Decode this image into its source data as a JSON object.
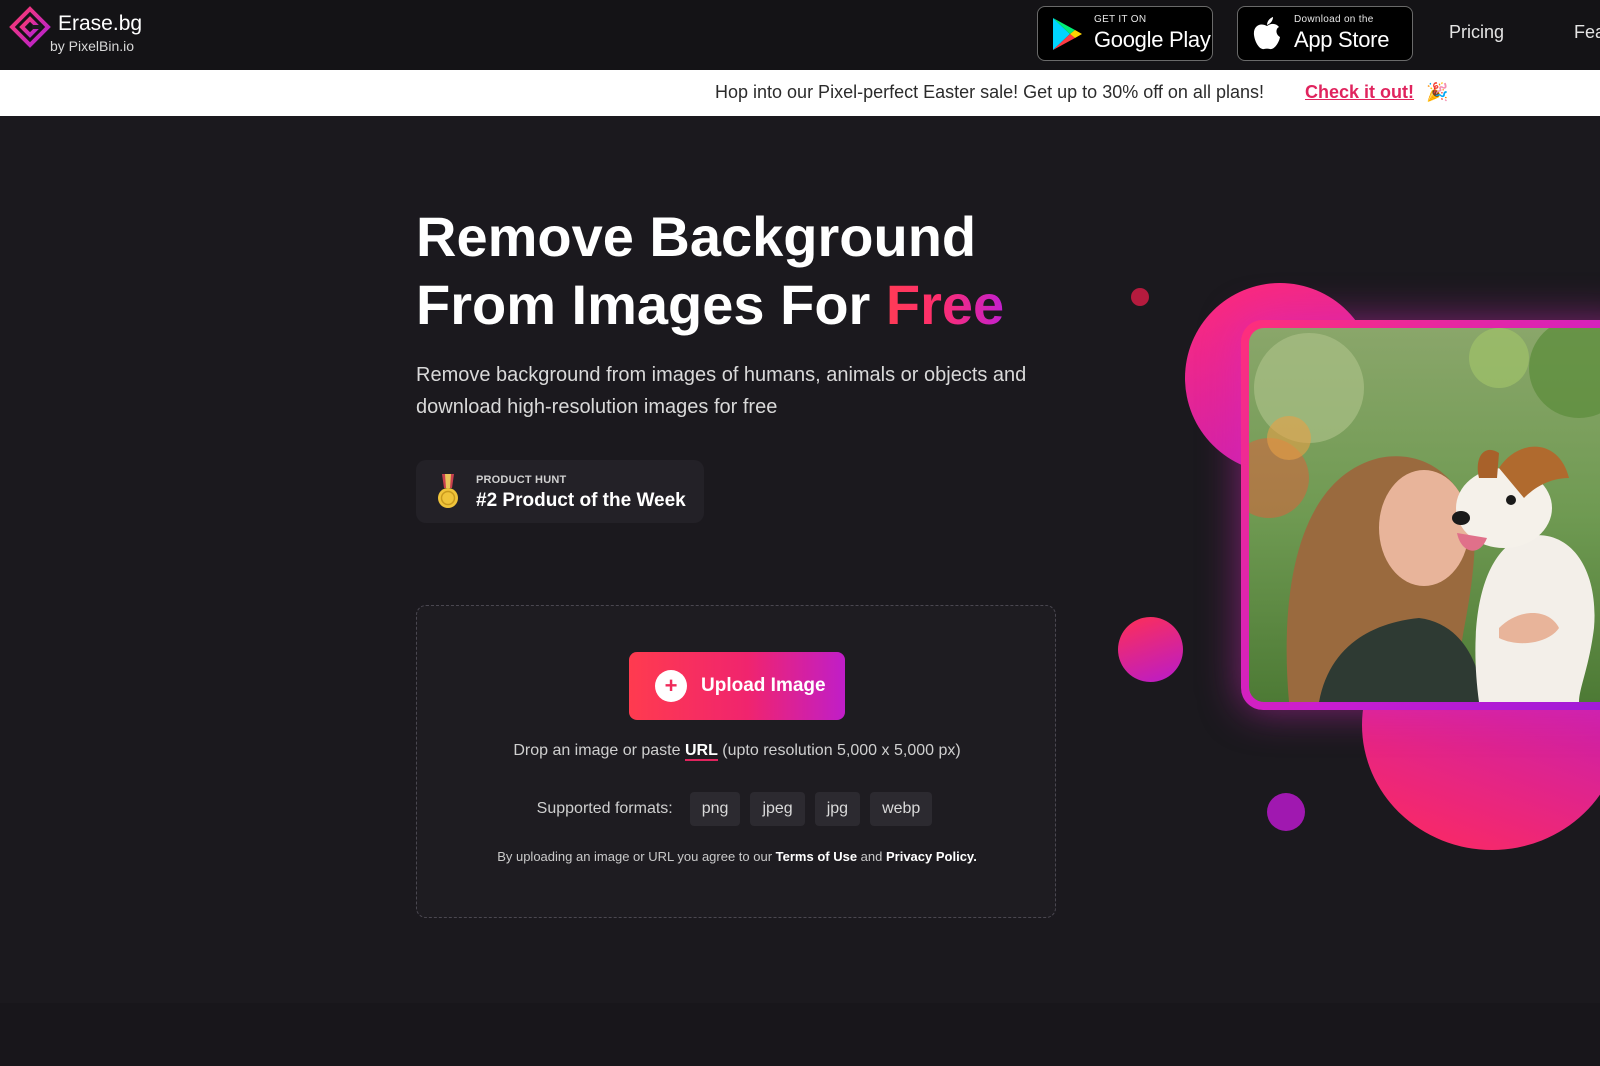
{
  "header": {
    "logo_title": "Erase.bg",
    "logo_sub": "by PixelBin.io",
    "google_play": {
      "small": "GET IT ON",
      "big": "Google Play"
    },
    "app_store": {
      "small": "Download on the",
      "big": "App Store"
    },
    "nav": [
      "Pricing",
      "Fea"
    ]
  },
  "promo": {
    "text": "Hop into our Pixel-perfect Easter sale! Get up to 30% off on all plans!",
    "link": "Check it out!",
    "emoji": "🎉"
  },
  "hero": {
    "title_line1": "Remove Background",
    "title_line2": "From Images For ",
    "title_highlight": "Free",
    "subtitle": "Remove background from images of humans, animals or objects and download high-resolution images for free",
    "badge": {
      "label": "PRODUCT HUNT",
      "title": "#2 Product of the Week"
    }
  },
  "upload": {
    "button_label": "Upload Image",
    "drop_prefix": "Drop an image or paste ",
    "drop_link": "URL",
    "drop_suffix": " (upto resolution 5,000 x 5,000 px)",
    "formats_label": "Supported formats:",
    "formats": [
      "png",
      "jpeg",
      "jpg",
      "webp"
    ],
    "terms_prefix": "By uploading an image or URL you agree to our ",
    "terms_link": "Terms of Use",
    "terms_mid": " and ",
    "privacy_link": "Privacy Policy."
  },
  "colors": {
    "accent_pink": "#e0245e",
    "accent_purple": "#c01ec8",
    "background": "#1b191e"
  },
  "icons": [
    "logo-icon",
    "google-play-icon",
    "apple-icon",
    "medal-icon",
    "plus-icon",
    "party-popper-icon"
  ]
}
